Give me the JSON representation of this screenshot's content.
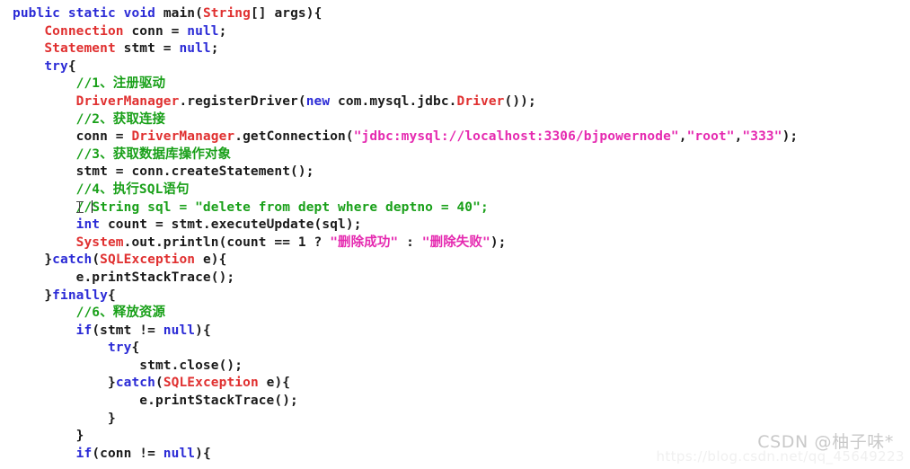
{
  "editor": {
    "language": "java",
    "colors": {
      "background": "#ffffff",
      "keyword": "#2b2bd6",
      "class_name": "#e03030",
      "comment": "#19a019",
      "string": "#e52ab0",
      "plain": "#1a1a1a"
    },
    "lines": [
      {
        "indent": 0,
        "tokens": [
          {
            "t": "kw",
            "v": "public"
          },
          {
            "t": "pln",
            "v": " "
          },
          {
            "t": "kw",
            "v": "static"
          },
          {
            "t": "pln",
            "v": " "
          },
          {
            "t": "kw",
            "v": "void"
          },
          {
            "t": "pln",
            "v": " main("
          },
          {
            "t": "cls",
            "v": "String"
          },
          {
            "t": "pln",
            "v": "[] args){"
          }
        ]
      },
      {
        "indent": 1,
        "tokens": [
          {
            "t": "cls",
            "v": "Connection"
          },
          {
            "t": "pln",
            "v": " conn = "
          },
          {
            "t": "kw",
            "v": "null"
          },
          {
            "t": "pln",
            "v": ";"
          }
        ]
      },
      {
        "indent": 1,
        "tokens": [
          {
            "t": "cls",
            "v": "Statement"
          },
          {
            "t": "pln",
            "v": " stmt = "
          },
          {
            "t": "kw",
            "v": "null"
          },
          {
            "t": "pln",
            "v": ";"
          }
        ]
      },
      {
        "indent": 1,
        "tokens": [
          {
            "t": "kw",
            "v": "try"
          },
          {
            "t": "pln",
            "v": "{"
          }
        ]
      },
      {
        "indent": 2,
        "tokens": [
          {
            "t": "cmt",
            "v": "//1、注册驱动"
          }
        ]
      },
      {
        "indent": 2,
        "tokens": [
          {
            "t": "cls",
            "v": "DriverManager"
          },
          {
            "t": "pln",
            "v": ".registerDriver("
          },
          {
            "t": "kw",
            "v": "new"
          },
          {
            "t": "pln",
            "v": " com.mysql.jdbc."
          },
          {
            "t": "cls",
            "v": "Driver"
          },
          {
            "t": "pln",
            "v": "());"
          }
        ]
      },
      {
        "indent": 2,
        "tokens": [
          {
            "t": "cmt",
            "v": "//2、获取连接"
          }
        ]
      },
      {
        "indent": 2,
        "tokens": [
          {
            "t": "pln",
            "v": "conn = "
          },
          {
            "t": "cls",
            "v": "DriverManager"
          },
          {
            "t": "pln",
            "v": ".getConnection("
          },
          {
            "t": "str",
            "v": "\"jdbc:mysql://localhost:3306/bjpowernode\""
          },
          {
            "t": "pln",
            "v": ","
          },
          {
            "t": "str",
            "v": "\"root\""
          },
          {
            "t": "pln",
            "v": ","
          },
          {
            "t": "str",
            "v": "\"333\""
          },
          {
            "t": "pln",
            "v": ");"
          }
        ]
      },
      {
        "indent": 2,
        "tokens": [
          {
            "t": "cmt",
            "v": "//3、获取数据库操作对象"
          }
        ]
      },
      {
        "indent": 2,
        "tokens": [
          {
            "t": "pln",
            "v": "stmt = conn.createStatement();"
          }
        ]
      },
      {
        "indent": 2,
        "tokens": [
          {
            "t": "cmt",
            "v": "//4、执行SQL语句"
          }
        ]
      },
      {
        "indent": 2,
        "caret_after": 2,
        "tokens": [
          {
            "t": "cmt",
            "v": "//"
          },
          {
            "t": "cmt",
            "v": "String sql = \"delete from dept where deptno = 40\";"
          }
        ]
      },
      {
        "indent": 2,
        "tokens": [
          {
            "t": "kw",
            "v": "int"
          },
          {
            "t": "pln",
            "v": " count = stmt.executeUpdate(sql);"
          }
        ]
      },
      {
        "indent": 2,
        "tokens": [
          {
            "t": "cls",
            "v": "System"
          },
          {
            "t": "pln",
            "v": ".out.println(count == 1 ? "
          },
          {
            "t": "str",
            "v": "\"删除成功\""
          },
          {
            "t": "pln",
            "v": " : "
          },
          {
            "t": "str",
            "v": "\"删除失败\""
          },
          {
            "t": "pln",
            "v": ");"
          }
        ]
      },
      {
        "indent": 1,
        "tokens": [
          {
            "t": "pln",
            "v": "}"
          },
          {
            "t": "kw",
            "v": "catch"
          },
          {
            "t": "pln",
            "v": "("
          },
          {
            "t": "cls",
            "v": "SQLException"
          },
          {
            "t": "pln",
            "v": " e){"
          }
        ]
      },
      {
        "indent": 2,
        "tokens": [
          {
            "t": "pln",
            "v": "e.printStackTrace();"
          }
        ]
      },
      {
        "indent": 1,
        "tokens": [
          {
            "t": "pln",
            "v": "}"
          },
          {
            "t": "kw",
            "v": "finally"
          },
          {
            "t": "pln",
            "v": "{"
          }
        ]
      },
      {
        "indent": 2,
        "tokens": [
          {
            "t": "cmt",
            "v": "//6、释放资源"
          }
        ]
      },
      {
        "indent": 2,
        "tokens": [
          {
            "t": "kw",
            "v": "if"
          },
          {
            "t": "pln",
            "v": "(stmt != "
          },
          {
            "t": "kw",
            "v": "null"
          },
          {
            "t": "pln",
            "v": "){"
          }
        ]
      },
      {
        "indent": 3,
        "tokens": [
          {
            "t": "kw",
            "v": "try"
          },
          {
            "t": "pln",
            "v": "{"
          }
        ]
      },
      {
        "indent": 4,
        "tokens": [
          {
            "t": "pln",
            "v": "stmt.close();"
          }
        ]
      },
      {
        "indent": 3,
        "tokens": [
          {
            "t": "pln",
            "v": "}"
          },
          {
            "t": "kw",
            "v": "catch"
          },
          {
            "t": "pln",
            "v": "("
          },
          {
            "t": "cls",
            "v": "SQLException"
          },
          {
            "t": "pln",
            "v": " e){"
          }
        ]
      },
      {
        "indent": 4,
        "tokens": [
          {
            "t": "pln",
            "v": "e.printStackTrace();"
          }
        ]
      },
      {
        "indent": 3,
        "tokens": [
          {
            "t": "pln",
            "v": "}"
          }
        ]
      },
      {
        "indent": 2,
        "tokens": [
          {
            "t": "pln",
            "v": "}"
          }
        ]
      },
      {
        "indent": 2,
        "tokens": [
          {
            "t": "kw",
            "v": "if"
          },
          {
            "t": "pln",
            "v": "(conn != "
          },
          {
            "t": "kw",
            "v": "null"
          },
          {
            "t": "pln",
            "v": "){"
          }
        ]
      }
    ]
  },
  "cursor": {
    "type": "i-beam-text-cursor"
  },
  "watermark": {
    "handle": "CSDN @柚子味*",
    "url": "https://blog.csdn.net/qq_45649223"
  }
}
